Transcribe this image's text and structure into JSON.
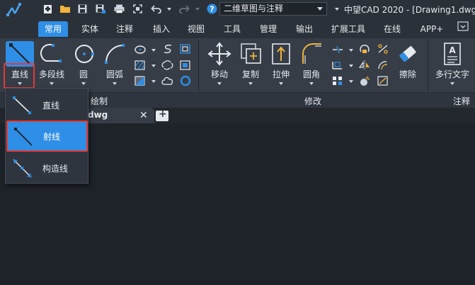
{
  "titlebar": {
    "workspace": "二维草图与注释",
    "app_title": "中望CAD 2020 - [Drawing1.dwg]"
  },
  "tabs": [
    {
      "label": "常用",
      "active": true
    },
    {
      "label": "实体"
    },
    {
      "label": "注释"
    },
    {
      "label": "插入"
    },
    {
      "label": "视图"
    },
    {
      "label": "工具"
    },
    {
      "label": "管理"
    },
    {
      "label": "输出"
    },
    {
      "label": "扩展工具"
    },
    {
      "label": "在线"
    },
    {
      "label": "APP+"
    }
  ],
  "ribbon": {
    "draw_group": "绘制",
    "modify_group": "修改",
    "annotate_group": "注释",
    "tools": {
      "line": "直线",
      "polyline": "多段线",
      "circle": "圆",
      "arc": "圆弧",
      "move": "移动",
      "copy": "复制",
      "stretch": "拉伸",
      "fillet": "圆角",
      "erase": "擦除",
      "mtext": "多行文字"
    }
  },
  "doc_tab": {
    "name": "dwg",
    "close": "✕"
  },
  "dropdown": {
    "items": [
      "直线",
      "射线",
      "构造线"
    ],
    "selected_index": 1
  },
  "colors": {
    "accent": "#2f8ee5",
    "highlight": "#e23a3a",
    "background": "#1e2229"
  }
}
